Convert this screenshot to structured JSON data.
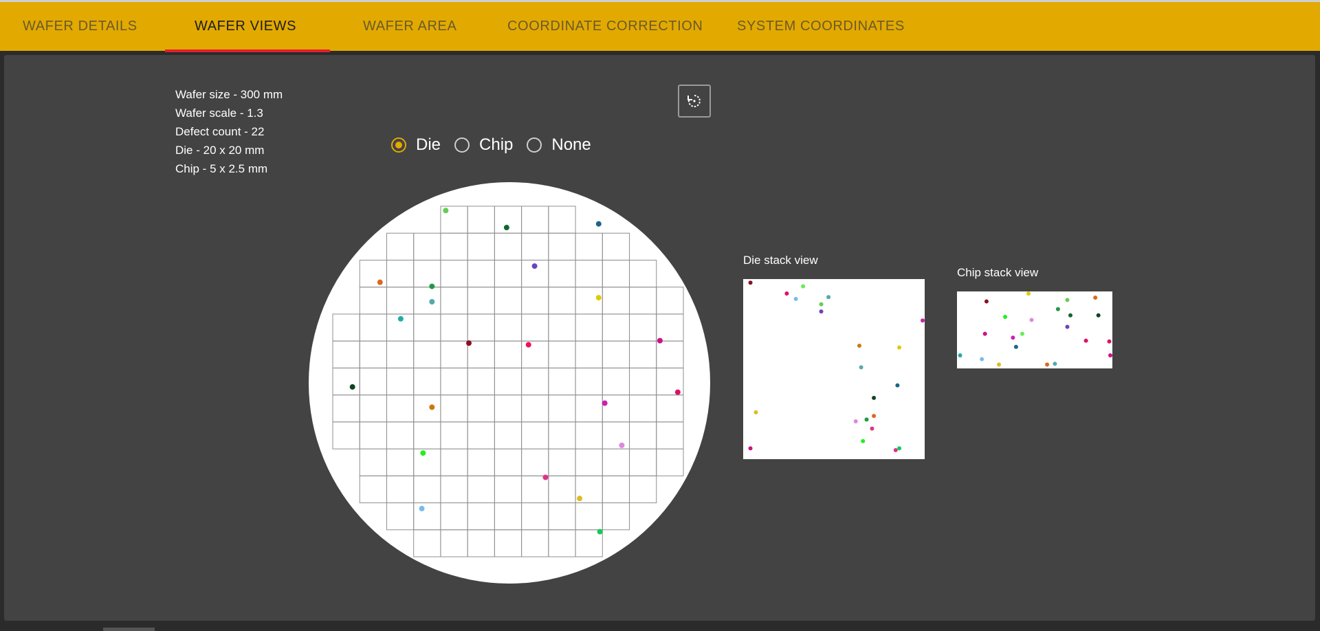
{
  "tabs": [
    {
      "label": "WAFER DETAILS",
      "active": false
    },
    {
      "label": "WAFER VIEWS",
      "active": true
    },
    {
      "label": "WAFER AREA",
      "active": false
    },
    {
      "label": "COORDINATE CORRECTION",
      "active": false
    },
    {
      "label": "SYSTEM COORDINATES",
      "active": false
    }
  ],
  "info": {
    "wafer_size": "Wafer size - 300 mm",
    "wafer_scale": "Wafer scale - 1.3",
    "defect_count": "Defect count - 22",
    "die": "Die - 20 x 20 mm",
    "chip": "Chip - 5 x 2.5 mm"
  },
  "view_mode": {
    "options": [
      "Die",
      "Chip",
      "None"
    ],
    "selected": "Die"
  },
  "refresh_icon": "refresh-icon",
  "colors": {
    "accent": "#e2a900",
    "active_tab_underline": "#e11f2f",
    "panel_bg": "#434343"
  },
  "wafer_map": {
    "grid": {
      "columns": 13,
      "rows": 13
    },
    "defects": [
      {
        "u": 0.343,
        "v": 0.075,
        "color": "#66cc55"
      },
      {
        "u": 0.493,
        "v": 0.117,
        "color": "#116633"
      },
      {
        "u": 0.72,
        "v": 0.108,
        "color": "#1a6688"
      },
      {
        "u": 0.562,
        "v": 0.212,
        "color": "#6a44bb"
      },
      {
        "u": 0.181,
        "v": 0.252,
        "color": "#dd6622"
      },
      {
        "u": 0.309,
        "v": 0.262,
        "color": "#229944"
      },
      {
        "u": 0.309,
        "v": 0.3,
        "color": "#55aaaa"
      },
      {
        "u": 0.72,
        "v": 0.29,
        "color": "#ddcc00"
      },
      {
        "u": 0.232,
        "v": 0.342,
        "color": "#22aaaa"
      },
      {
        "u": 0.4,
        "v": 0.402,
        "color": "#881122"
      },
      {
        "u": 0.547,
        "v": 0.406,
        "color": "#ee1155"
      },
      {
        "u": 0.871,
        "v": 0.396,
        "color": "#cc1188"
      },
      {
        "u": 0.113,
        "v": 0.51,
        "color": "#114422"
      },
      {
        "u": 0.915,
        "v": 0.523,
        "color": "#dd1166"
      },
      {
        "u": 0.309,
        "v": 0.56,
        "color": "#cc7711"
      },
      {
        "u": 0.735,
        "v": 0.55,
        "color": "#cc22aa"
      },
      {
        "u": 0.777,
        "v": 0.654,
        "color": "#dd88dd"
      },
      {
        "u": 0.287,
        "v": 0.673,
        "color": "#22ee22"
      },
      {
        "u": 0.589,
        "v": 0.733,
        "color": "#dd3388"
      },
      {
        "u": 0.673,
        "v": 0.785,
        "color": "#ddbb22"
      },
      {
        "u": 0.284,
        "v": 0.81,
        "color": "#77bbee"
      },
      {
        "u": 0.723,
        "v": 0.867,
        "color": "#11cc55"
      }
    ]
  },
  "die_stack": {
    "title": "Die stack view",
    "points": [
      {
        "u": 0.04,
        "v": 0.02,
        "color": "#881122"
      },
      {
        "u": 0.24,
        "v": 0.08,
        "color": "#dd1166"
      },
      {
        "u": 0.29,
        "v": 0.11,
        "color": "#77bbee"
      },
      {
        "u": 0.33,
        "v": 0.04,
        "color": "#66ee55"
      },
      {
        "u": 0.43,
        "v": 0.14,
        "color": "#66cc55"
      },
      {
        "u": 0.43,
        "v": 0.18,
        "color": "#6a44bb"
      },
      {
        "u": 0.47,
        "v": 0.1,
        "color": "#55aaaa"
      },
      {
        "u": 1.0,
        "v": 0.23,
        "color": "#cc22aa"
      },
      {
        "u": 0.64,
        "v": 0.37,
        "color": "#cc7711"
      },
      {
        "u": 0.86,
        "v": 0.38,
        "color": "#ddcc00"
      },
      {
        "u": 0.65,
        "v": 0.49,
        "color": "#55aaaa"
      },
      {
        "u": 0.85,
        "v": 0.59,
        "color": "#1a6688"
      },
      {
        "u": 0.72,
        "v": 0.66,
        "color": "#114422"
      },
      {
        "u": 0.07,
        "v": 0.74,
        "color": "#ddbb22"
      },
      {
        "u": 0.72,
        "v": 0.76,
        "color": "#dd6622"
      },
      {
        "u": 0.68,
        "v": 0.78,
        "color": "#229944"
      },
      {
        "u": 0.62,
        "v": 0.79,
        "color": "#dd88dd"
      },
      {
        "u": 0.71,
        "v": 0.83,
        "color": "#dd3388"
      },
      {
        "u": 0.66,
        "v": 0.9,
        "color": "#22ee22"
      },
      {
        "u": 0.04,
        "v": 0.94,
        "color": "#cc1188"
      },
      {
        "u": 0.84,
        "v": 0.95,
        "color": "#dd3388"
      },
      {
        "u": 0.86,
        "v": 0.94,
        "color": "#11cc55"
      }
    ]
  },
  "chip_stack": {
    "title": "Chip stack view",
    "points": [
      {
        "u": 0.19,
        "v": 0.13,
        "color": "#881122"
      },
      {
        "u": 0.46,
        "v": 0.02,
        "color": "#ddcc00"
      },
      {
        "u": 0.71,
        "v": 0.11,
        "color": "#66cc55"
      },
      {
        "u": 0.89,
        "v": 0.08,
        "color": "#dd6622"
      },
      {
        "u": 0.31,
        "v": 0.33,
        "color": "#22ee22"
      },
      {
        "u": 0.65,
        "v": 0.23,
        "color": "#229944"
      },
      {
        "u": 0.73,
        "v": 0.31,
        "color": "#116633"
      },
      {
        "u": 0.91,
        "v": 0.31,
        "color": "#114422"
      },
      {
        "u": 0.48,
        "v": 0.37,
        "color": "#dd88dd"
      },
      {
        "u": 0.71,
        "v": 0.46,
        "color": "#6a44bb"
      },
      {
        "u": 0.18,
        "v": 0.55,
        "color": "#cc1188"
      },
      {
        "u": 0.42,
        "v": 0.55,
        "color": "#66ee55"
      },
      {
        "u": 0.36,
        "v": 0.6,
        "color": "#cc22aa"
      },
      {
        "u": 0.83,
        "v": 0.64,
        "color": "#dd1166"
      },
      {
        "u": 0.98,
        "v": 0.65,
        "color": "#dd1166"
      },
      {
        "u": 0.38,
        "v": 0.72,
        "color": "#1a6688"
      },
      {
        "u": 0.02,
        "v": 0.83,
        "color": "#22aaaa"
      },
      {
        "u": 0.16,
        "v": 0.88,
        "color": "#77bbee"
      },
      {
        "u": 0.27,
        "v": 0.95,
        "color": "#ddbb22"
      },
      {
        "u": 0.58,
        "v": 0.95,
        "color": "#dd6622"
      },
      {
        "u": 0.63,
        "v": 0.94,
        "color": "#55aaaa"
      },
      {
        "u": 1.0,
        "v": 0.83,
        "color": "#cc1188"
      }
    ]
  }
}
